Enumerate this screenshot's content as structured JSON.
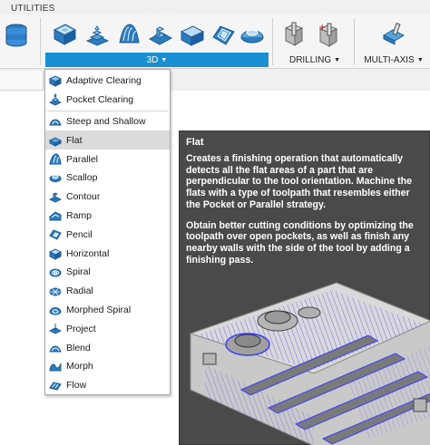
{
  "ribbon": {
    "tab_label": "UTILITIES",
    "groups": {
      "g3d": "3D",
      "drilling": "DRILLING",
      "multiaxis": "MULTI-AXIS"
    },
    "caret": "▼"
  },
  "menu": {
    "items": [
      {
        "label": "Adaptive Clearing",
        "icon": "adaptive-clearing-icon"
      },
      {
        "label": "Pocket Clearing",
        "icon": "pocket-clearing-icon"
      },
      {
        "label": "Steep and Shallow",
        "icon": "steep-shallow-icon"
      },
      {
        "label": "Flat",
        "icon": "flat-icon"
      },
      {
        "label": "Parallel",
        "icon": "parallel-icon"
      },
      {
        "label": "Scallop",
        "icon": "scallop-icon"
      },
      {
        "label": "Contour",
        "icon": "contour-icon"
      },
      {
        "label": "Ramp",
        "icon": "ramp-icon"
      },
      {
        "label": "Pencil",
        "icon": "pencil-icon"
      },
      {
        "label": "Horizontal",
        "icon": "horizontal-icon"
      },
      {
        "label": "Spiral",
        "icon": "spiral-icon"
      },
      {
        "label": "Radial",
        "icon": "radial-icon"
      },
      {
        "label": "Morphed Spiral",
        "icon": "morphed-spiral-icon"
      },
      {
        "label": "Project",
        "icon": "project-icon"
      },
      {
        "label": "Blend",
        "icon": "blend-icon"
      },
      {
        "label": "Morph",
        "icon": "morph-icon"
      },
      {
        "label": "Flow",
        "icon": "flow-icon"
      }
    ]
  },
  "tooltip": {
    "title": "Flat",
    "paragraph1": "Creates a finishing operation that automatically detects all the flat areas of a part that are perpendicular to the tool orientation. Machine the flats with a type of toolpath that resembles either the Pocket or Parallel strategy.",
    "paragraph2": "Obtain better cutting conditions by optimizing the toolpath over open pockets, as well as finish any nearby walls with the side of the tool by adding a finishing pass."
  },
  "colors": {
    "accent": "#1a8fd1",
    "tooltip_bg": "#4a4a4a",
    "toolpath": "#6a5cff"
  }
}
